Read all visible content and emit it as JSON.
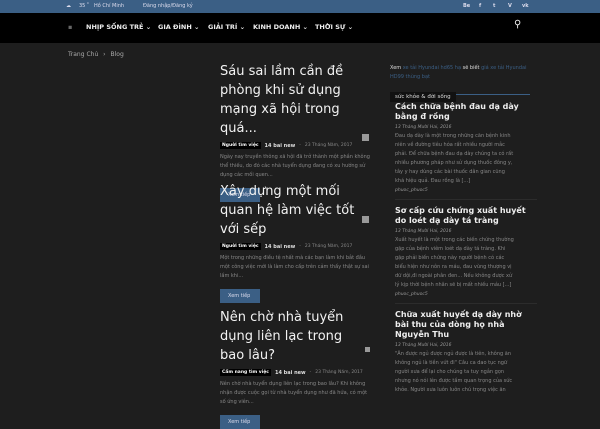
{
  "topbar": {
    "temp": "35",
    "unit": "C",
    "city": "Hồ Chí Minh",
    "login": "Đăng nhập/Đăng ký",
    "social": [
      "Be",
      "f",
      "t",
      "V",
      "vk"
    ]
  },
  "nav": {
    "items": [
      "NHỊP SỐNG TRẺ",
      "GIA ĐÌNH",
      "GIẢI TRÍ",
      "KINH DOANH",
      "THỜI SỰ"
    ]
  },
  "breadcrumb": {
    "home": "Trang Chủ",
    "sep": "›",
    "current": "Blog"
  },
  "posts": [
    {
      "title": "Sáu sai lầm cần đề phòng khi sử dụng mạng xã hội trong quá...",
      "category": "Người tìm việc",
      "author": "14 bai new",
      "date": "23 Tháng Năm, 2017",
      "excerpt": "Ngày nay truyền thông xã hội đã trở thành một phần không thể thiếu, do đó các nhà tuyển dụng đang có xu hướng sử dụng các mối quen...",
      "button": "Xem tiếp"
    },
    {
      "title": "Xây dựng một mối quan hệ làm việc tốt với sếp",
      "category": "Người tìm việc",
      "author": "14 bai new",
      "date": "23 Tháng Năm, 2017",
      "excerpt": "Một trong những điều tệ nhất mà các bạn làm khi bắt đầu một công việc mới là làm cho cấp trên cảm thấy thật sự sai lầm khi...",
      "button": "Xem tiếp"
    },
    {
      "title": "Nên chờ nhà tuyển dụng liên lạc trong bao lâu?",
      "category": "Cẩm nang tìm việc",
      "author": "14 bai new",
      "date": "23 Tháng Năm, 2017",
      "excerpt": "Nên chờ nhà tuyển dụng liên lạc trong bao lâu? Khi không nhận được cuộc gọi từ nhà tuyển dụng như đã hứa, có một số ứng viên...",
      "button": "Xem tiếp"
    }
  ],
  "sidebar": {
    "promo": {
      "prefix": "Xem",
      "link1": "xe tải Hyundai hd65 hạ",
      "middle": "sẽ biết",
      "link2": "giá xe tải Hyundai HD99 thùng bạt"
    },
    "section": "sức khỏe & đời sống",
    "posts": [
      {
        "title": "Cách chữa bệnh đau dạ dày bằng đ rồng",
        "date": "13 Tháng Mười Hai, 2016",
        "excerpt": "Đau dạ dày là một trong những căn bệnh kinh niên về đường tiêu hóa rất nhiều người mắc phải. Để chữa bệnh đau dạ dày chúng ta có rất nhiều phương pháp như sử dụng thuốc đông y, tây y hay dùng các bài thuốc dân gian cũng khá hiệu quả. Đau rồng là [...]",
        "author": "phuoc_phuoc5"
      },
      {
        "title": "Sơ cấp cứu chứng xuất huyết do loét dạ dày tá tràng",
        "date": "13 Tháng Mười Hai, 2016",
        "excerpt": "Xuất huyết là một trong các biến chứng thường gặp của bệnh viêm loét dạ dày tá tràng. Khi gặp phải biến chứng này người bệnh có các biểu hiện như nôn ra máu, đau vùng thượng vị dữ dội,đi ngoài phân đen... Nếu không được xử lý kịp thời bệnh nhân sẽ bị mất nhiều máu [...]",
        "author": "phuoc_phuoc5"
      },
      {
        "title": "Chữa xuất huyết dạ dày nhờ bài thu của dòng họ nhà Nguyễn Thu",
        "date": "13 Tháng Mười Hai, 2016",
        "excerpt": "\"Ăn được ngủ được ngủ được là tiên, không ăn không ngủ là tiền vứt đi\" Câu ca dao tục ngữ người xưa để lại cho chúng ta tuy ngắn gọn nhưng nó nói lên được tầm quan trọng của sức khỏe. Người xưa luôn luôn chú trọng việc ăn",
        "author": ""
      }
    ]
  }
}
